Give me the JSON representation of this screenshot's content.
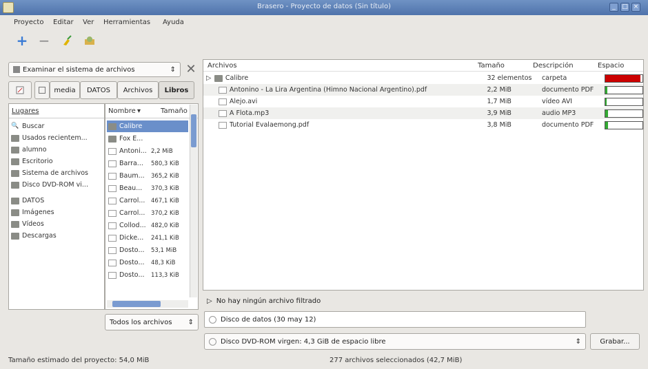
{
  "window": {
    "title": "Brasero - Proyecto de datos (Sin título)"
  },
  "menu": [
    "Proyecto",
    "Editar",
    "Ver",
    "Herramientas",
    "Ayuda"
  ],
  "toolbar": {
    "add": "+",
    "remove": "−",
    "colors": {
      "add": "#3a7bd5",
      "remove": "#888888",
      "clean": "#e0b400"
    }
  },
  "browser": {
    "selector": "Examinar el sistema de archivos",
    "path_buttons": [
      "media",
      "DATOS",
      "Archivos",
      "Libros"
    ],
    "places_header": "Lugares",
    "places": [
      "Buscar",
      "Usados recientem...",
      "alumno",
      "Escritorio",
      "Sistema de archivos",
      "Disco DVD-ROM vi...",
      "DATOS",
      "Imágenes",
      "Vídeos",
      "Descargas"
    ],
    "columns": [
      "Nombre",
      "Tamaño"
    ],
    "files": [
      {
        "name": "Calibre",
        "size": "",
        "selected": true
      },
      {
        "name": "Fox E...",
        "size": ""
      },
      {
        "name": "Antoni...",
        "size": "2,2 MiB"
      },
      {
        "name": "Barra...",
        "size": "580,3 KiB"
      },
      {
        "name": "Baum...",
        "size": "365,2 KiB"
      },
      {
        "name": "Beau...",
        "size": "370,3 KiB"
      },
      {
        "name": "Carrol...",
        "size": "467,1 KiB"
      },
      {
        "name": "Carrol...",
        "size": "370,2 KiB"
      },
      {
        "name": "Collod...",
        "size": "482,0 KiB"
      },
      {
        "name": "Dicke...",
        "size": "241,1 KiB"
      },
      {
        "name": "Dosto...",
        "size": "53,1 MiB"
      },
      {
        "name": "Dosto...",
        "size": "48,3 KiB"
      },
      {
        "name": "Dosto...",
        "size": "113,3 KiB"
      }
    ],
    "filter": "Todos los archivos"
  },
  "project": {
    "columns": [
      "Archivos",
      "Tamaño",
      "Descripción",
      "Espacio"
    ],
    "files": [
      {
        "name": "Calibre",
        "size": "32 elementos",
        "desc": "carpeta",
        "space": 0.95,
        "color": "#cc0000",
        "folder": true
      },
      {
        "name": "Antonino - La Lira Argentina (Himno Nacional Argentino).pdf",
        "size": "2,2 MiB",
        "desc": "documento PDF",
        "space": 0.04,
        "color": "#33aa33"
      },
      {
        "name": "Alejo.avi",
        "size": "1,7 MiB",
        "desc": "vídeo AVI",
        "space": 0.03,
        "color": "#33aa33"
      },
      {
        "name": "A Flota.mp3",
        "size": "3,9 MiB",
        "desc": "audio MP3",
        "space": 0.06,
        "color": "#33aa33"
      },
      {
        "name": "Tutorial Evalaemong.pdf",
        "size": "3,8 MiB",
        "desc": "documento PDF",
        "space": 0.06,
        "color": "#33aa33"
      }
    ],
    "filtered": "No hay ningún archivo filtrado",
    "disc_name": "Disco de datos (30 may 12)",
    "drive": "Disco DVD-ROM virgen: 4,3 GiB de espacio libre",
    "burn": "Grabar..."
  },
  "status": {
    "left": "Tamaño estimado del proyecto: 54,0 MiB",
    "center": "277 archivos seleccionados (42,7 MiB)"
  }
}
